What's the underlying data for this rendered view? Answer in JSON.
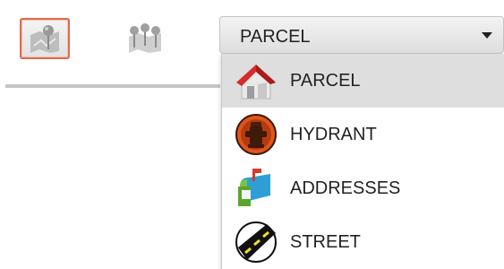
{
  "toolbar": {
    "single_tool_icon": "map-pin-icon",
    "multi_tool_icon": "map-multi-pin-icon"
  },
  "layer_select": {
    "value": "PARCEL",
    "caret_icon": "caret-down-icon",
    "options": [
      {
        "label": "PARCEL",
        "icon": "house-icon",
        "selected": true
      },
      {
        "label": "HYDRANT",
        "icon": "hydrant-icon",
        "selected": false
      },
      {
        "label": "ADDRESSES",
        "icon": "mailbox-icon",
        "selected": false
      },
      {
        "label": "STREET",
        "icon": "road-icon",
        "selected": false
      }
    ]
  }
}
